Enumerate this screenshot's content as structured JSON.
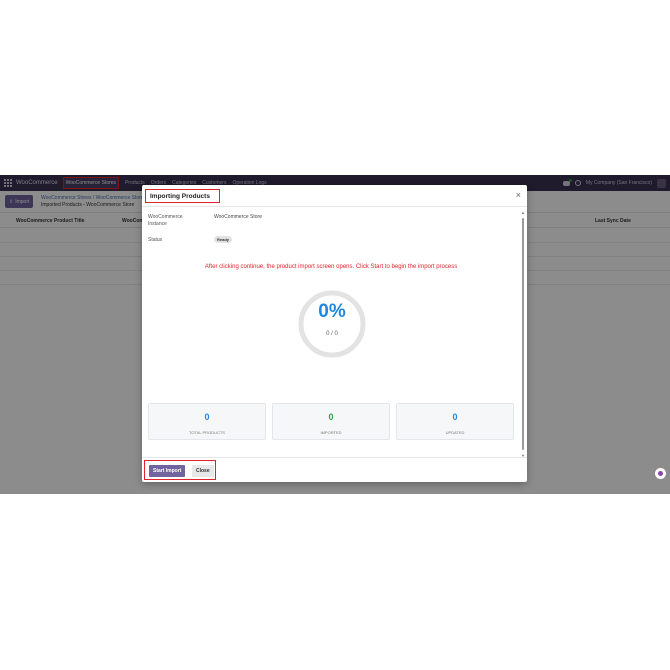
{
  "navbar": {
    "brand": "WooCommerce",
    "items": [
      "WooCommerce Stores",
      "Products",
      "Orders",
      "Categories",
      "Customers",
      "Operation Logs"
    ],
    "company": "My Company (San Francisco)"
  },
  "control": {
    "import_label": "Import",
    "breadcrumb": "WooCommerce Stores / WooCommerce Store",
    "subtitle": "Imported Products - WooCommerce Store"
  },
  "list": {
    "columns": [
      "WooCommerce Product Title",
      "WooCommerce",
      "Last Sync Date"
    ]
  },
  "modal": {
    "title": "Importing Products",
    "instance_label": "WooCommerce Instance",
    "instance_value": "WooCommerce Store",
    "status_label": "Status",
    "status_value": "Ready",
    "info_message": "After clicking continue, the product import screen opens. Click Start to begin the import process",
    "progress": {
      "percent_text": "0%",
      "fraction_text": "0 / 0",
      "value": 0
    },
    "stats": [
      {
        "value": "0",
        "label": "TOTAL PRODUCTS",
        "color": "#1e88e5"
      },
      {
        "value": "0",
        "label": "IMPORTED",
        "color": "#28a745"
      },
      {
        "value": "0",
        "label": "UPDATED",
        "color": "#1e88e5"
      }
    ],
    "start_label": "Start Import",
    "close_label": "Close"
  },
  "colors": {
    "navbar": "#3a3051",
    "primary": "#71639e",
    "highlight": "#e0242b",
    "progress_text": "#1e88e5"
  }
}
